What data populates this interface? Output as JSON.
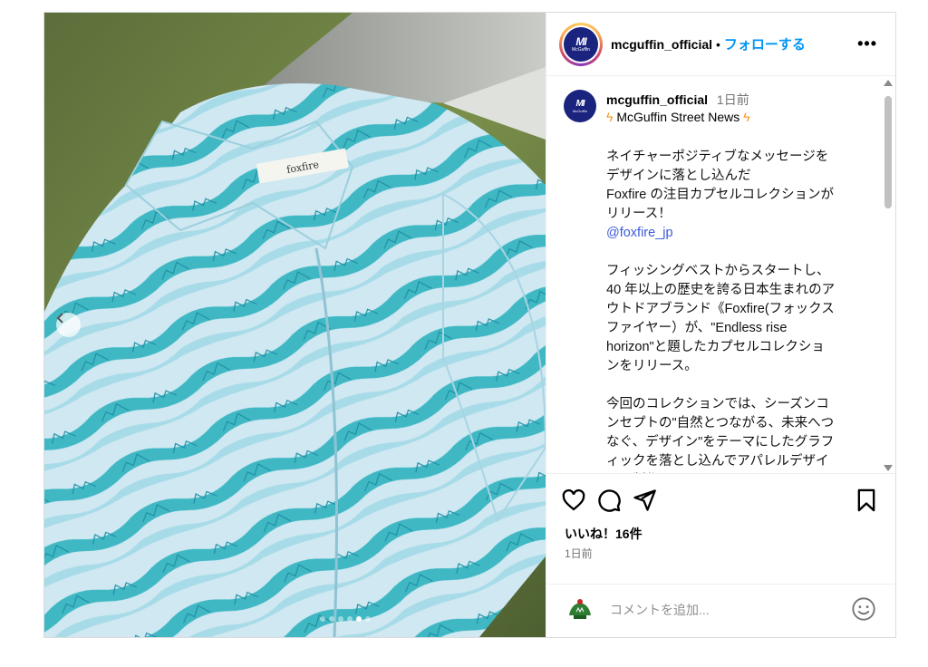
{
  "header": {
    "username": "mcguffin_official",
    "separator": "•",
    "follow_label": "フォローする",
    "more_label": "•••"
  },
  "avatar": {
    "mark": "MI",
    "brand": "McGuffin"
  },
  "post": {
    "username": "mcguffin_official",
    "time": "1日前",
    "title": "McGuffin Street News",
    "body_1": "ネイチャーポジティブなメッセージを\nデザインに落とし込んだ\nFoxfire の注目カプセルコレクションが\nリリース！",
    "mention": "@foxfire_jp",
    "body_2": "フィッシングベストからスタートし、\n40 年以上の歴史を誇る日本生まれのア\nウトドアブランド《Foxfire(フォックス\nファイヤー）が、\"Endless rise\nhorizon\"と題したカプセルコレクショ\nンをリリース。",
    "body_3": "今回のコレクションでは、シーズンコ\nンセプトの\"自然とつながる、未来へつ\nなぐ、デザイン\"をテーマにしたグラフ\nィックを落とし込んでアパレルデザイ\nンを制作。"
  },
  "shirt_label": "foxfire",
  "likes": "いいね！16件",
  "date": "1日前",
  "comment": {
    "placeholder": "コメントを追加..."
  },
  "carousel": {
    "total": 6,
    "active": 5
  },
  "colors": {
    "follow": "#0095f6",
    "mention": "#3b5bdb",
    "bolt": "#f7931e"
  }
}
